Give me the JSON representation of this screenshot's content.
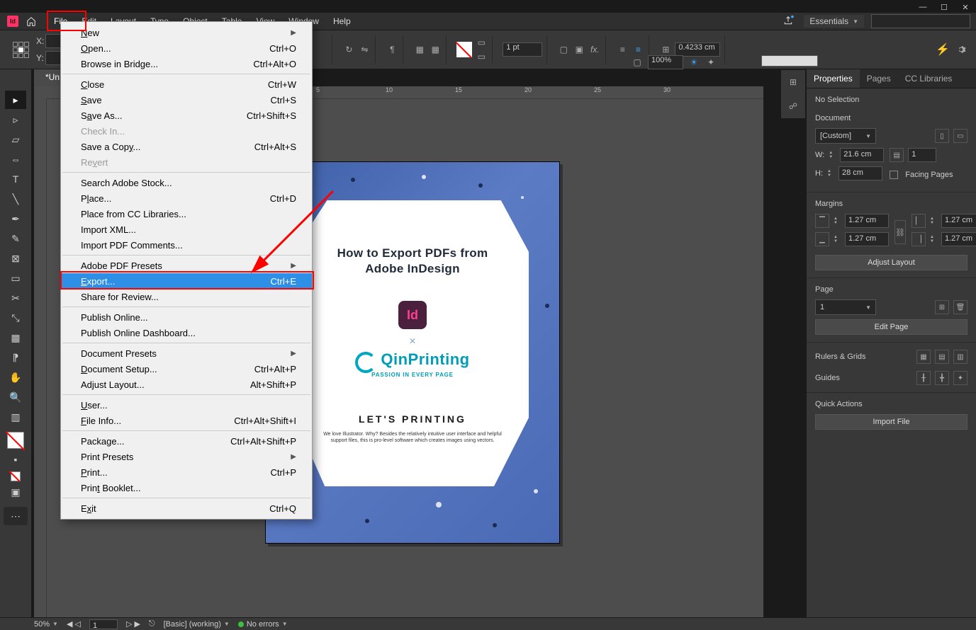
{
  "menubar": {
    "items": [
      "File",
      "Edit",
      "Layout",
      "Type",
      "Object",
      "Table",
      "View",
      "Window",
      "Help"
    ],
    "workspace": "Essentials"
  },
  "controlbar": {
    "x_label": "X:",
    "y_label": "Y:",
    "stroke_weight": "1 pt",
    "opacity": "100%",
    "offset": "0.4233 cm"
  },
  "doc_tab": "*Un",
  "ruler_h_marks": [
    "5",
    "10",
    "15",
    "20",
    "25",
    "30"
  ],
  "dropdown": {
    "groups": [
      [
        {
          "label": "New",
          "shortcut": "",
          "arrow": true,
          "hotkey": "N"
        },
        {
          "label": "Open...",
          "shortcut": "Ctrl+O",
          "hotkey": "O"
        },
        {
          "label": "Browse in Bridge...",
          "shortcut": "Ctrl+Alt+O"
        }
      ],
      [
        {
          "label": "Close",
          "shortcut": "Ctrl+W",
          "hotkey": "C"
        },
        {
          "label": "Save",
          "shortcut": "Ctrl+S",
          "hotkey": "S"
        },
        {
          "label": "Save As...",
          "shortcut": "Ctrl+Shift+S",
          "hotkey": "A"
        },
        {
          "label": "Check In...",
          "disabled": true
        },
        {
          "label": "Save a Copy...",
          "shortcut": "Ctrl+Alt+S",
          "hotkey": "y"
        },
        {
          "label": "Revert",
          "disabled": true,
          "hotkey": "v"
        }
      ],
      [
        {
          "label": "Search Adobe Stock..."
        },
        {
          "label": "Place...",
          "shortcut": "Ctrl+D",
          "hotkey": "L"
        },
        {
          "label": "Place from CC Libraries..."
        },
        {
          "label": "Import XML..."
        },
        {
          "label": "Import PDF Comments..."
        }
      ],
      [
        {
          "label": "Adobe PDF Presets",
          "arrow": true
        },
        {
          "label": "Export...",
          "shortcut": "Ctrl+E",
          "highlighted": true,
          "hotkey": "E"
        },
        {
          "label": "Share for Review..."
        }
      ],
      [
        {
          "label": "Publish Online..."
        },
        {
          "label": "Publish Online Dashboard..."
        }
      ],
      [
        {
          "label": "Document Presets",
          "arrow": true
        },
        {
          "label": "Document Setup...",
          "shortcut": "Ctrl+Alt+P",
          "hotkey": "D"
        },
        {
          "label": "Adjust Layout...",
          "shortcut": "Alt+Shift+P"
        }
      ],
      [
        {
          "label": "User...",
          "hotkey": "U"
        },
        {
          "label": "File Info...",
          "shortcut": "Ctrl+Alt+Shift+I",
          "hotkey": "F"
        }
      ],
      [
        {
          "label": "Package...",
          "shortcut": "Ctrl+Alt+Shift+P",
          "hotkey": "g"
        },
        {
          "label": "Print Presets",
          "arrow": true
        },
        {
          "label": "Print...",
          "shortcut": "Ctrl+P",
          "hotkey": "P"
        },
        {
          "label": "Print Booklet...",
          "hotkey": "t"
        }
      ],
      [
        {
          "label": "Exit",
          "shortcut": "Ctrl+Q",
          "hotkey": "x"
        }
      ]
    ]
  },
  "page_art": {
    "title_line1": "How to Export PDFs from",
    "title_line2": "Adobe InDesign",
    "id_badge": "Id",
    "cross": "✕",
    "brand": "QinPrinting",
    "tagline": "PASSION IN EVERY PAGE",
    "headline": "LET'S PRINTING",
    "blurb": "We love Illustrator. Why? Besides the relatively intuitive user interface and helpful support files, this is pro-level software which creates images using vectors."
  },
  "properties": {
    "tab_props": "Properties",
    "tab_pages": "Pages",
    "tab_cc": "CC Libraries",
    "no_selection": "No Selection",
    "doc_section": "Document",
    "preset": "[Custom]",
    "w_label": "W:",
    "w_value": "21.6 cm",
    "h_label": "H:",
    "h_value": "28 cm",
    "facing": "Facing Pages",
    "pages_field": "1",
    "margins_section": "Margins",
    "margin_val": "1.27 cm",
    "adjust_layout": "Adjust Layout",
    "page_section": "Page",
    "page_num": "1",
    "edit_page": "Edit Page",
    "rulers_section": "Rulers & Grids",
    "guides_section": "Guides",
    "quick_section": "Quick Actions",
    "import_file": "Import File"
  },
  "status": {
    "zoom": "50%",
    "page": "1",
    "profile": "[Basic] (working)",
    "errors": "No errors"
  }
}
